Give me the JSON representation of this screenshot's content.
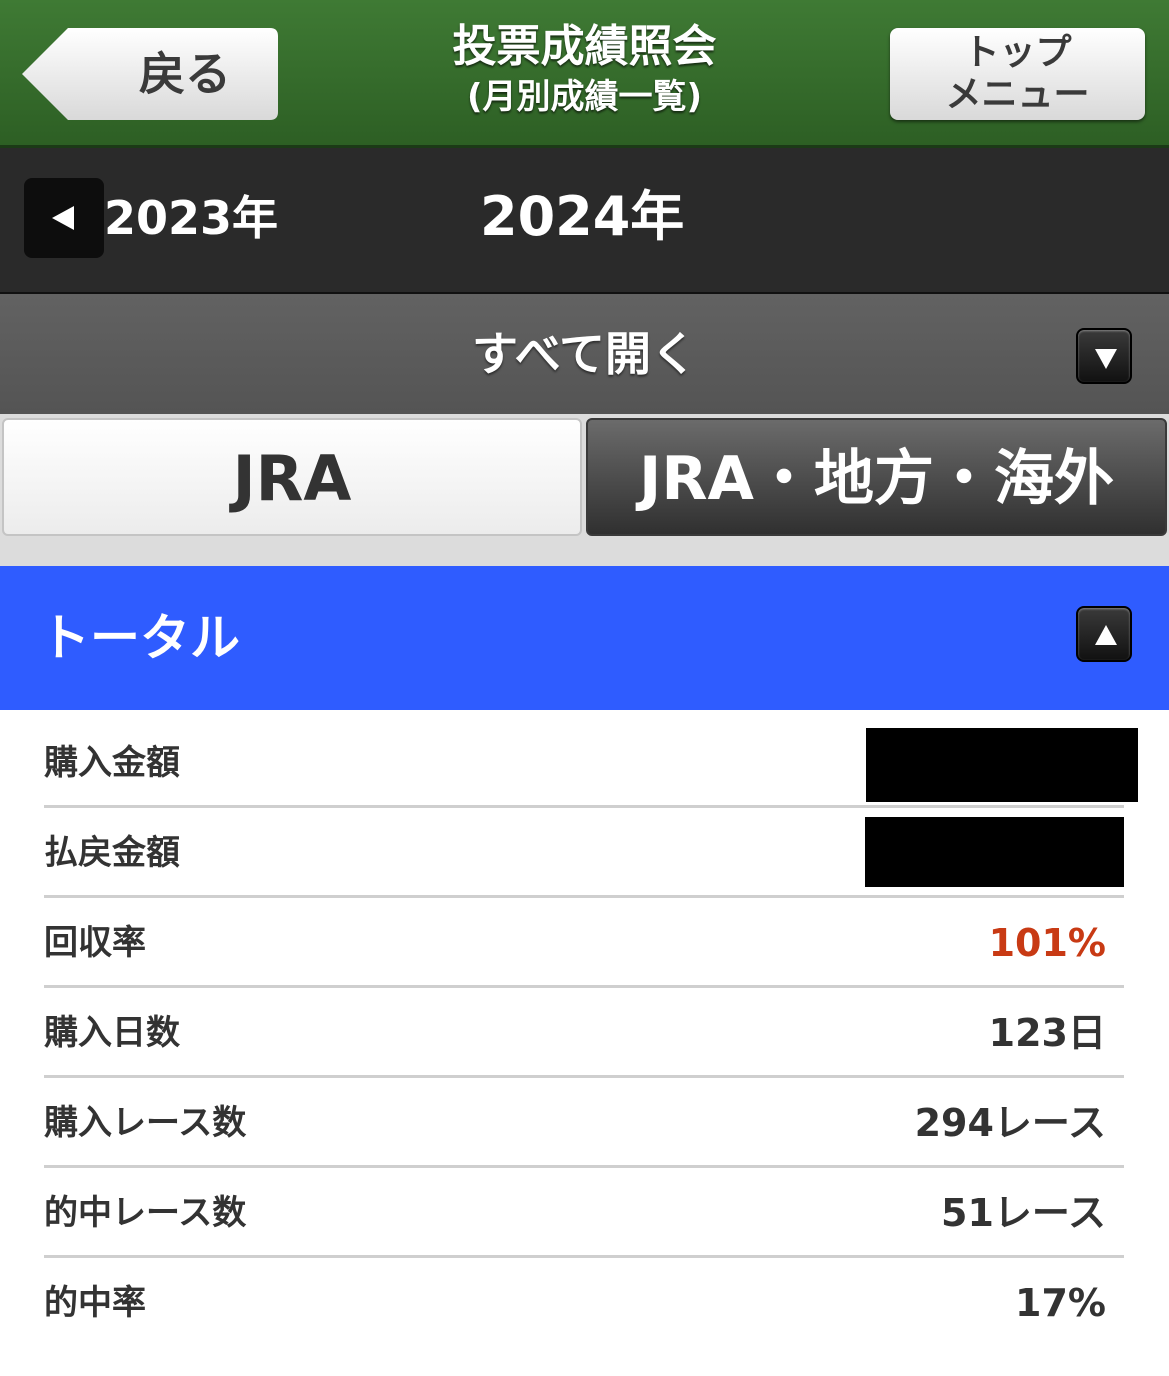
{
  "header": {
    "back_label": "戻る",
    "title": "投票成績照会",
    "subtitle": "(月別成績一覧)",
    "top_menu_line1": "トップ",
    "top_menu_line2": "メニュー"
  },
  "year_nav": {
    "previous_year": "2023年",
    "current_year": "2024年",
    "previous_icon": "triangle-left-icon"
  },
  "expand": {
    "label": "すべて開く",
    "icon": "triangle-down-icon"
  },
  "tabs": [
    {
      "label": "JRA",
      "selected": true
    },
    {
      "label": "JRA・地方・海外",
      "selected": false
    }
  ],
  "total": {
    "label": "トータル",
    "icon": "triangle-up-icon"
  },
  "stats": [
    {
      "label": "購入金額",
      "value": "",
      "redacted": true
    },
    {
      "label": "払戻金額",
      "value": "",
      "redacted": true
    },
    {
      "label": "回収率",
      "value": "101%",
      "accent": true
    },
    {
      "label": "購入日数",
      "value": "123日"
    },
    {
      "label": "購入レース数",
      "value": "294レース"
    },
    {
      "label": "的中レース数",
      "value": "51レース"
    },
    {
      "label": "的中率",
      "value": "17%"
    }
  ],
  "colors": {
    "header_green": "#3f7a34",
    "total_blue": "#2f5cff",
    "accent_red": "#c83a14"
  }
}
